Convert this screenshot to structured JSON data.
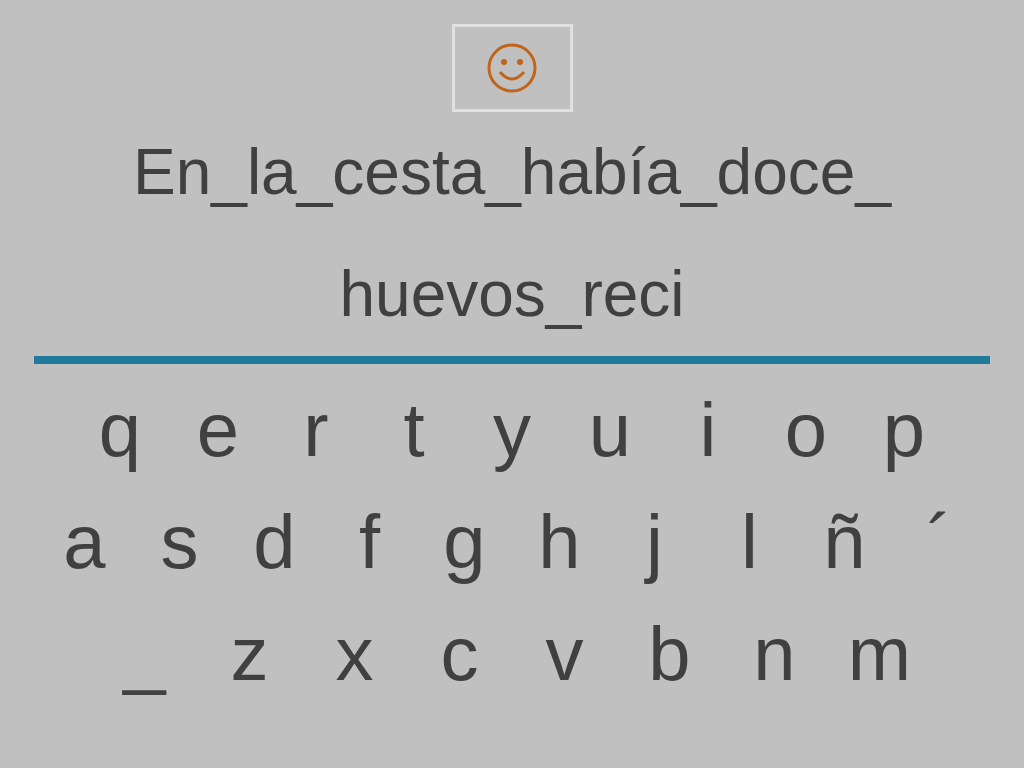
{
  "sentence_lines": [
    "En_la_cesta_había_doce_",
    "huevos_reci"
  ],
  "keyboard_rows": [
    [
      "q",
      "e",
      "r",
      "t",
      "y",
      "u",
      "i",
      "o",
      "p"
    ],
    [
      "a",
      "s",
      "d",
      "f",
      "g",
      "h",
      "j",
      "l",
      "ñ",
      "´"
    ],
    [
      "_",
      "z",
      "x",
      "c",
      "v",
      "b",
      "n",
      "m"
    ]
  ]
}
